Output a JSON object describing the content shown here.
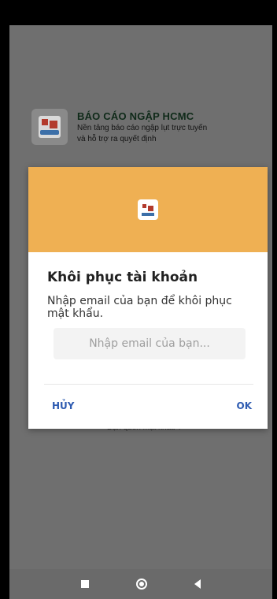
{
  "header": {
    "title": "BÁO CÁO NGẬP HCMC",
    "subtitle_line1": "Nền tảng báo cáo ngập lụt trực tuyến",
    "subtitle_line2": "và hỗ trợ ra quyết định"
  },
  "behind_dialog": {
    "forgot_password_text": "Bạn quên mật khẩu ?"
  },
  "dialog": {
    "title": "Khôi phục tài khoản",
    "message": "Nhập email của bạn để khôi phục mật khẩu.",
    "email_input": {
      "value": "",
      "placeholder": "Nhập email của bạn..."
    },
    "cancel_label": "HỦY",
    "ok_label": "OK"
  },
  "colors": {
    "dialog_header": "#efb053",
    "button_text": "#2e5bb1",
    "overlay": "#6f6f6f"
  },
  "icons": {
    "app_logo": "app-logo-icon",
    "nav_recent": "square-icon",
    "nav_home": "circle-icon",
    "nav_back": "triangle-back-icon"
  }
}
